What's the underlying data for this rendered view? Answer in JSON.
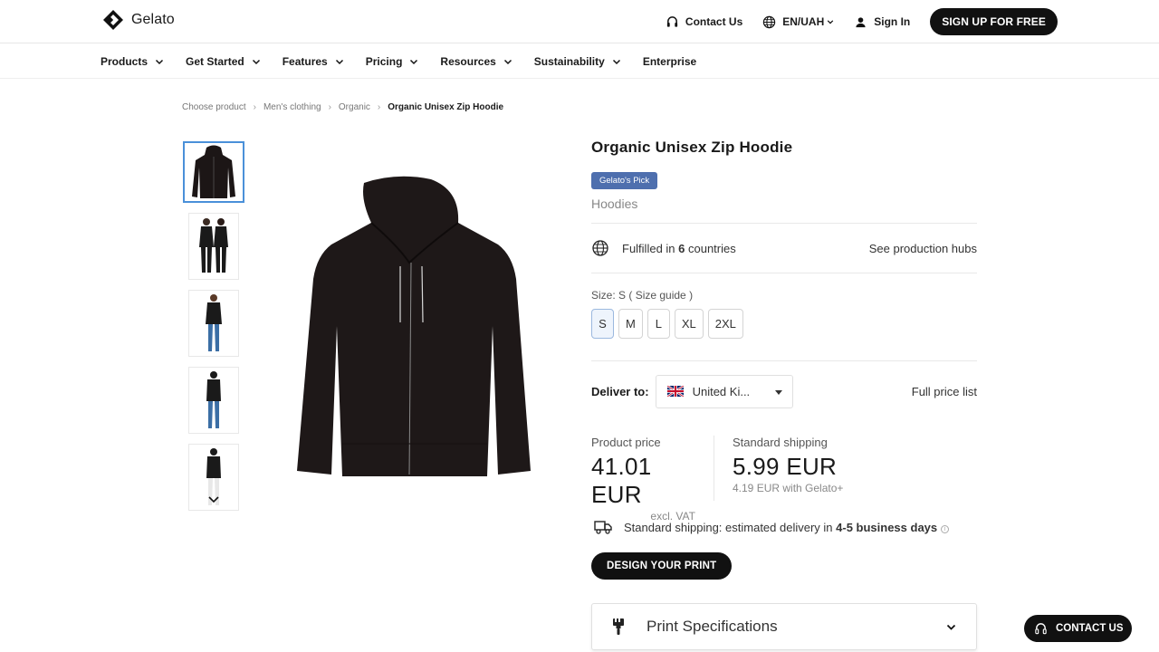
{
  "header": {
    "logo_text": "Gelato",
    "contact": "Contact Us",
    "language": "EN/UAH",
    "sign_in": "Sign In",
    "signup": "SIGN UP FOR FREE"
  },
  "nav": {
    "items": [
      {
        "label": "Products",
        "dropdown": true
      },
      {
        "label": "Get Started",
        "dropdown": true
      },
      {
        "label": "Features",
        "dropdown": true
      },
      {
        "label": "Pricing",
        "dropdown": true
      },
      {
        "label": "Resources",
        "dropdown": true
      },
      {
        "label": "Sustainability",
        "dropdown": true
      },
      {
        "label": "Enterprise",
        "dropdown": false
      }
    ]
  },
  "breadcrumb": [
    "Choose product",
    "Men's clothing",
    "Organic",
    "Organic Unisex Zip Hoodie"
  ],
  "product": {
    "title": "Organic Unisex Zip Hoodie",
    "badge": "Gelato's Pick",
    "category": "Hoodies",
    "fulfilled_prefix": "Fulfilled in ",
    "fulfilled_count": "6",
    "fulfilled_suffix": " countries",
    "production_hubs": "See production hubs",
    "size_prefix": "Size: S ( ",
    "size_guide": "Size guide",
    "size_suffix": " )",
    "sizes": [
      "S",
      "M",
      "L",
      "XL",
      "2XL"
    ],
    "selected_size": "S",
    "deliver_label": "Deliver to:",
    "country": "United Ki...",
    "full_price_list": "Full price list",
    "product_price_label": "Product price",
    "product_price": "41.01 EUR",
    "product_price_note": "excl. VAT",
    "shipping_label": "Standard shipping",
    "shipping_price": "5.99 EUR",
    "shipping_note": "4.19 EUR with Gelato+",
    "delivery_prefix": "Standard shipping: estimated delivery in ",
    "delivery_days": "4-5 business days",
    "design_button": "DESIGN YOUR PRINT",
    "specs_label": "Print Specifications"
  },
  "float_contact": "CONTACT US",
  "colors": {
    "badge": "#4e6fae",
    "thumb_active_border": "#4a90d9",
    "button_dark": "#111111"
  }
}
